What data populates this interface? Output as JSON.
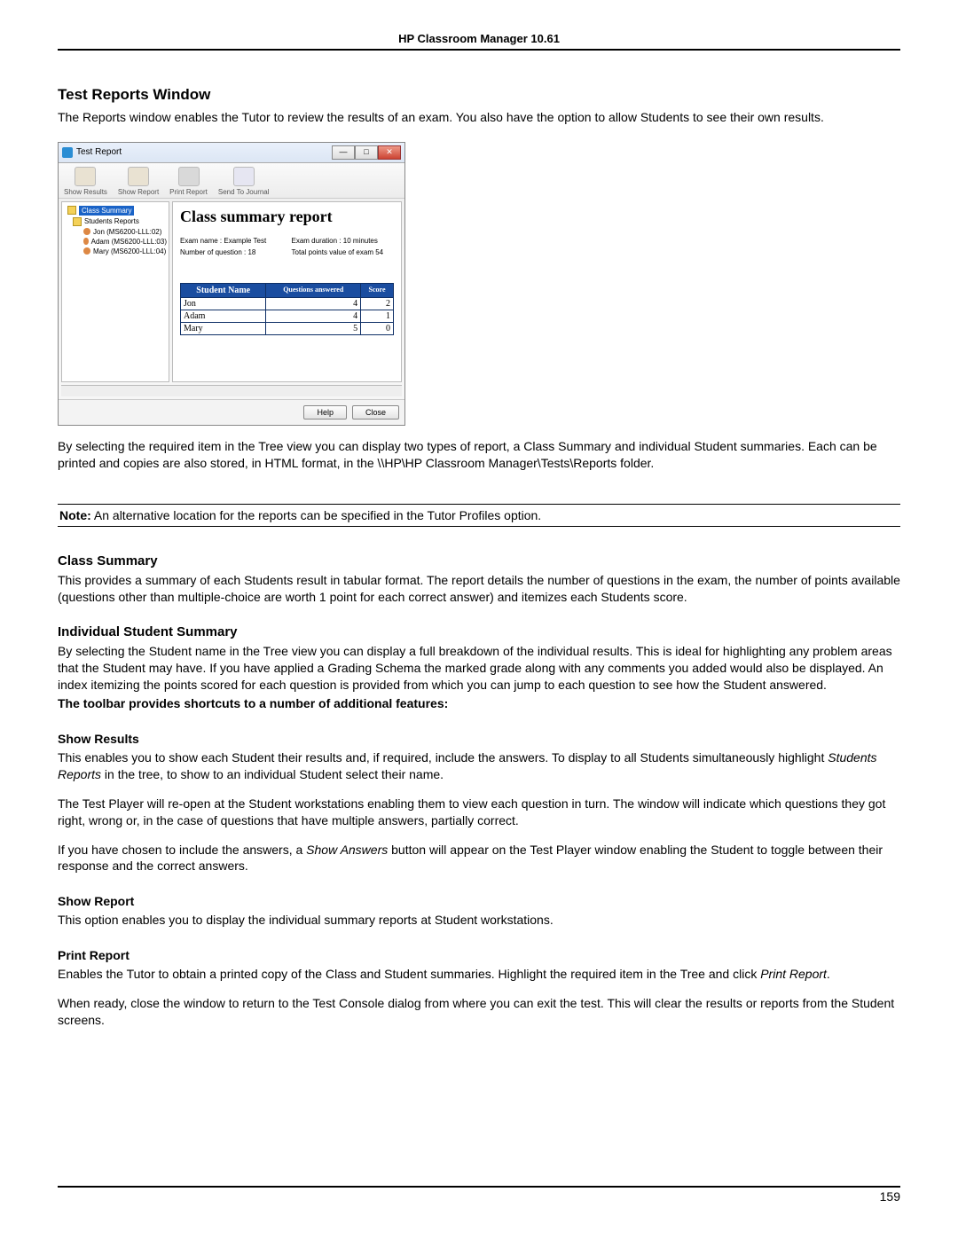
{
  "header": {
    "title": "HP Classroom Manager 10.61"
  },
  "section": {
    "title": "Test Reports Window",
    "intro": "The Reports window enables the Tutor to review the results of an exam. You also have the option to allow Students to see their own results."
  },
  "screenshot": {
    "window_title": "Test Report",
    "toolbar": {
      "show_results": "Show Results",
      "show_report": "Show Report",
      "print_report": "Print Report",
      "send_journal": "Send To Journal"
    },
    "tree": {
      "class_summary": "Class Summary",
      "students_reports": "Students Reports",
      "items": [
        "Jon (MS6200-LLL:02)",
        "Adam (MS6200-LLL:03)",
        "Mary (MS6200-LLL:04)"
      ]
    },
    "report": {
      "title": "Class summary report",
      "meta": {
        "exam_name": "Exam name : Example Test",
        "exam_duration": "Exam duration : 10 minutes",
        "num_questions": "Number of question : 18",
        "total_points": "Total points value of exam 54"
      },
      "columns": {
        "name": "Student Name",
        "answered": "Questions answered",
        "score": "Score"
      },
      "rows": [
        {
          "name": "Jon",
          "answered": 4,
          "score": 2
        },
        {
          "name": "Adam",
          "answered": 4,
          "score": 1
        },
        {
          "name": "Mary",
          "answered": 5,
          "score": 0
        }
      ]
    },
    "buttons": {
      "help": "Help",
      "close": "Close"
    }
  },
  "after_shot": "By selecting the required item in the Tree view you can display two types of report, a Class Summary and individual Student summaries. Each can be printed and copies are also stored, in HTML format, in the \\\\HP\\HP Classroom Manager\\Tests\\Reports folder.",
  "note": {
    "label": "Note:",
    "text": " An alternative location for the reports can be specified in the Tutor Profiles option."
  },
  "class_summary": {
    "heading": "Class Summary",
    "text": "This provides a summary of each Students result in tabular format. The report details the number of questions in the exam, the number of points available (questions other than multiple-choice are worth 1 point for each correct answer) and itemizes each Students score."
  },
  "individual": {
    "heading": "Individual Student Summary",
    "text": "By selecting the Student name in the Tree view you can display a full breakdown of the individual results. This is ideal for highlighting any problem areas that the Student may have. If you have applied a Grading Schema the marked grade along with any comments you added would also be displayed. An index itemizing the points scored for each question is provided from which you can jump to each question to see how the Student answered."
  },
  "toolbar_line": "The toolbar provides shortcuts to a number of additional features:",
  "show_results": {
    "heading": "Show Results",
    "p1a": "This enables you to show each Student their results and, if required, include the answers. To display to all Students simultaneously highlight ",
    "p1_em": "Students Reports",
    "p1b": " in the tree, to show to an individual Student select their name.",
    "p2": "The Test Player will re-open at the Student workstations enabling them to view each question in turn. The window will indicate which questions they got right, wrong or, in the case of questions that have multiple answers, partially correct.",
    "p3a": "If you have chosen to include the answers, a ",
    "p3_em": "Show Answers",
    "p3b": " button will appear on the Test Player window enabling the Student to toggle between their response and the correct answers."
  },
  "show_report": {
    "heading": "Show Report",
    "text": "This option enables you to display the individual summary reports at Student workstations."
  },
  "print_report": {
    "heading": "Print Report",
    "p1a": "Enables the Tutor to obtain a printed copy of the Class and Student summaries. Highlight the required item in the Tree and click ",
    "p1_em": "Print Report",
    "p1b": ".",
    "p2": "When ready, close the window to return to the Test Console dialog from where you can exit the test. This will clear the results or reports from the Student screens."
  },
  "footer": {
    "page": "159"
  }
}
